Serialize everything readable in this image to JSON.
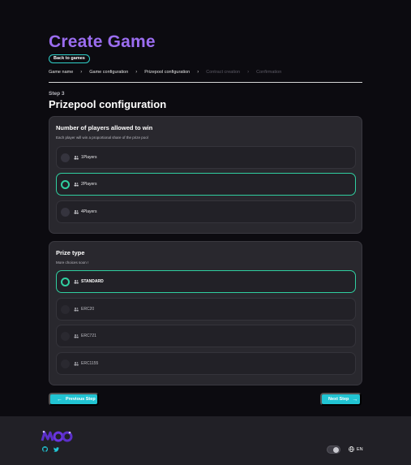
{
  "page": {
    "title": "Create Game",
    "back_label": "Back to games"
  },
  "breadcrumb": [
    {
      "label": "Game name",
      "state": "done"
    },
    {
      "label": "Game configuration",
      "state": "done"
    },
    {
      "label": "Prizepool configuration",
      "state": "current"
    },
    {
      "label": "Contract creation",
      "state": "upcoming"
    },
    {
      "label": "Confirmation",
      "state": "upcoming"
    }
  ],
  "step": {
    "label": "Step 3",
    "title": "Prizepool configuration"
  },
  "players_card": {
    "title": "Number of players allowed to win",
    "subtitle": "Each player will win a proportional share of the prize pool",
    "options": [
      {
        "label": "1Players",
        "selected": false
      },
      {
        "label": "2Players",
        "selected": true
      },
      {
        "label": "4Players",
        "selected": false
      }
    ]
  },
  "prize_card": {
    "title": "Prize type",
    "subtitle": "More choices soon !",
    "options": [
      {
        "label": "STANDARD",
        "selected": true,
        "enabled": true
      },
      {
        "label": "ERC20",
        "selected": false,
        "enabled": false
      },
      {
        "label": "ERC721",
        "selected": false,
        "enabled": false
      },
      {
        "label": "ERC1155",
        "selected": false,
        "enabled": false
      }
    ]
  },
  "navigation": {
    "previous_label": "Previous Step",
    "next_label": "Next Step"
  },
  "footer": {
    "language": "EN",
    "icons": [
      "logo",
      "github-icon",
      "twitter-icon",
      "theme-toggle",
      "globe-icon"
    ]
  },
  "colors": {
    "background": "#0c0b10",
    "title": "#9b6df0",
    "accent_cyan": "#21c4d3",
    "selected_green": "#30cfa0",
    "card": "#29282e",
    "footer": "#212026"
  }
}
